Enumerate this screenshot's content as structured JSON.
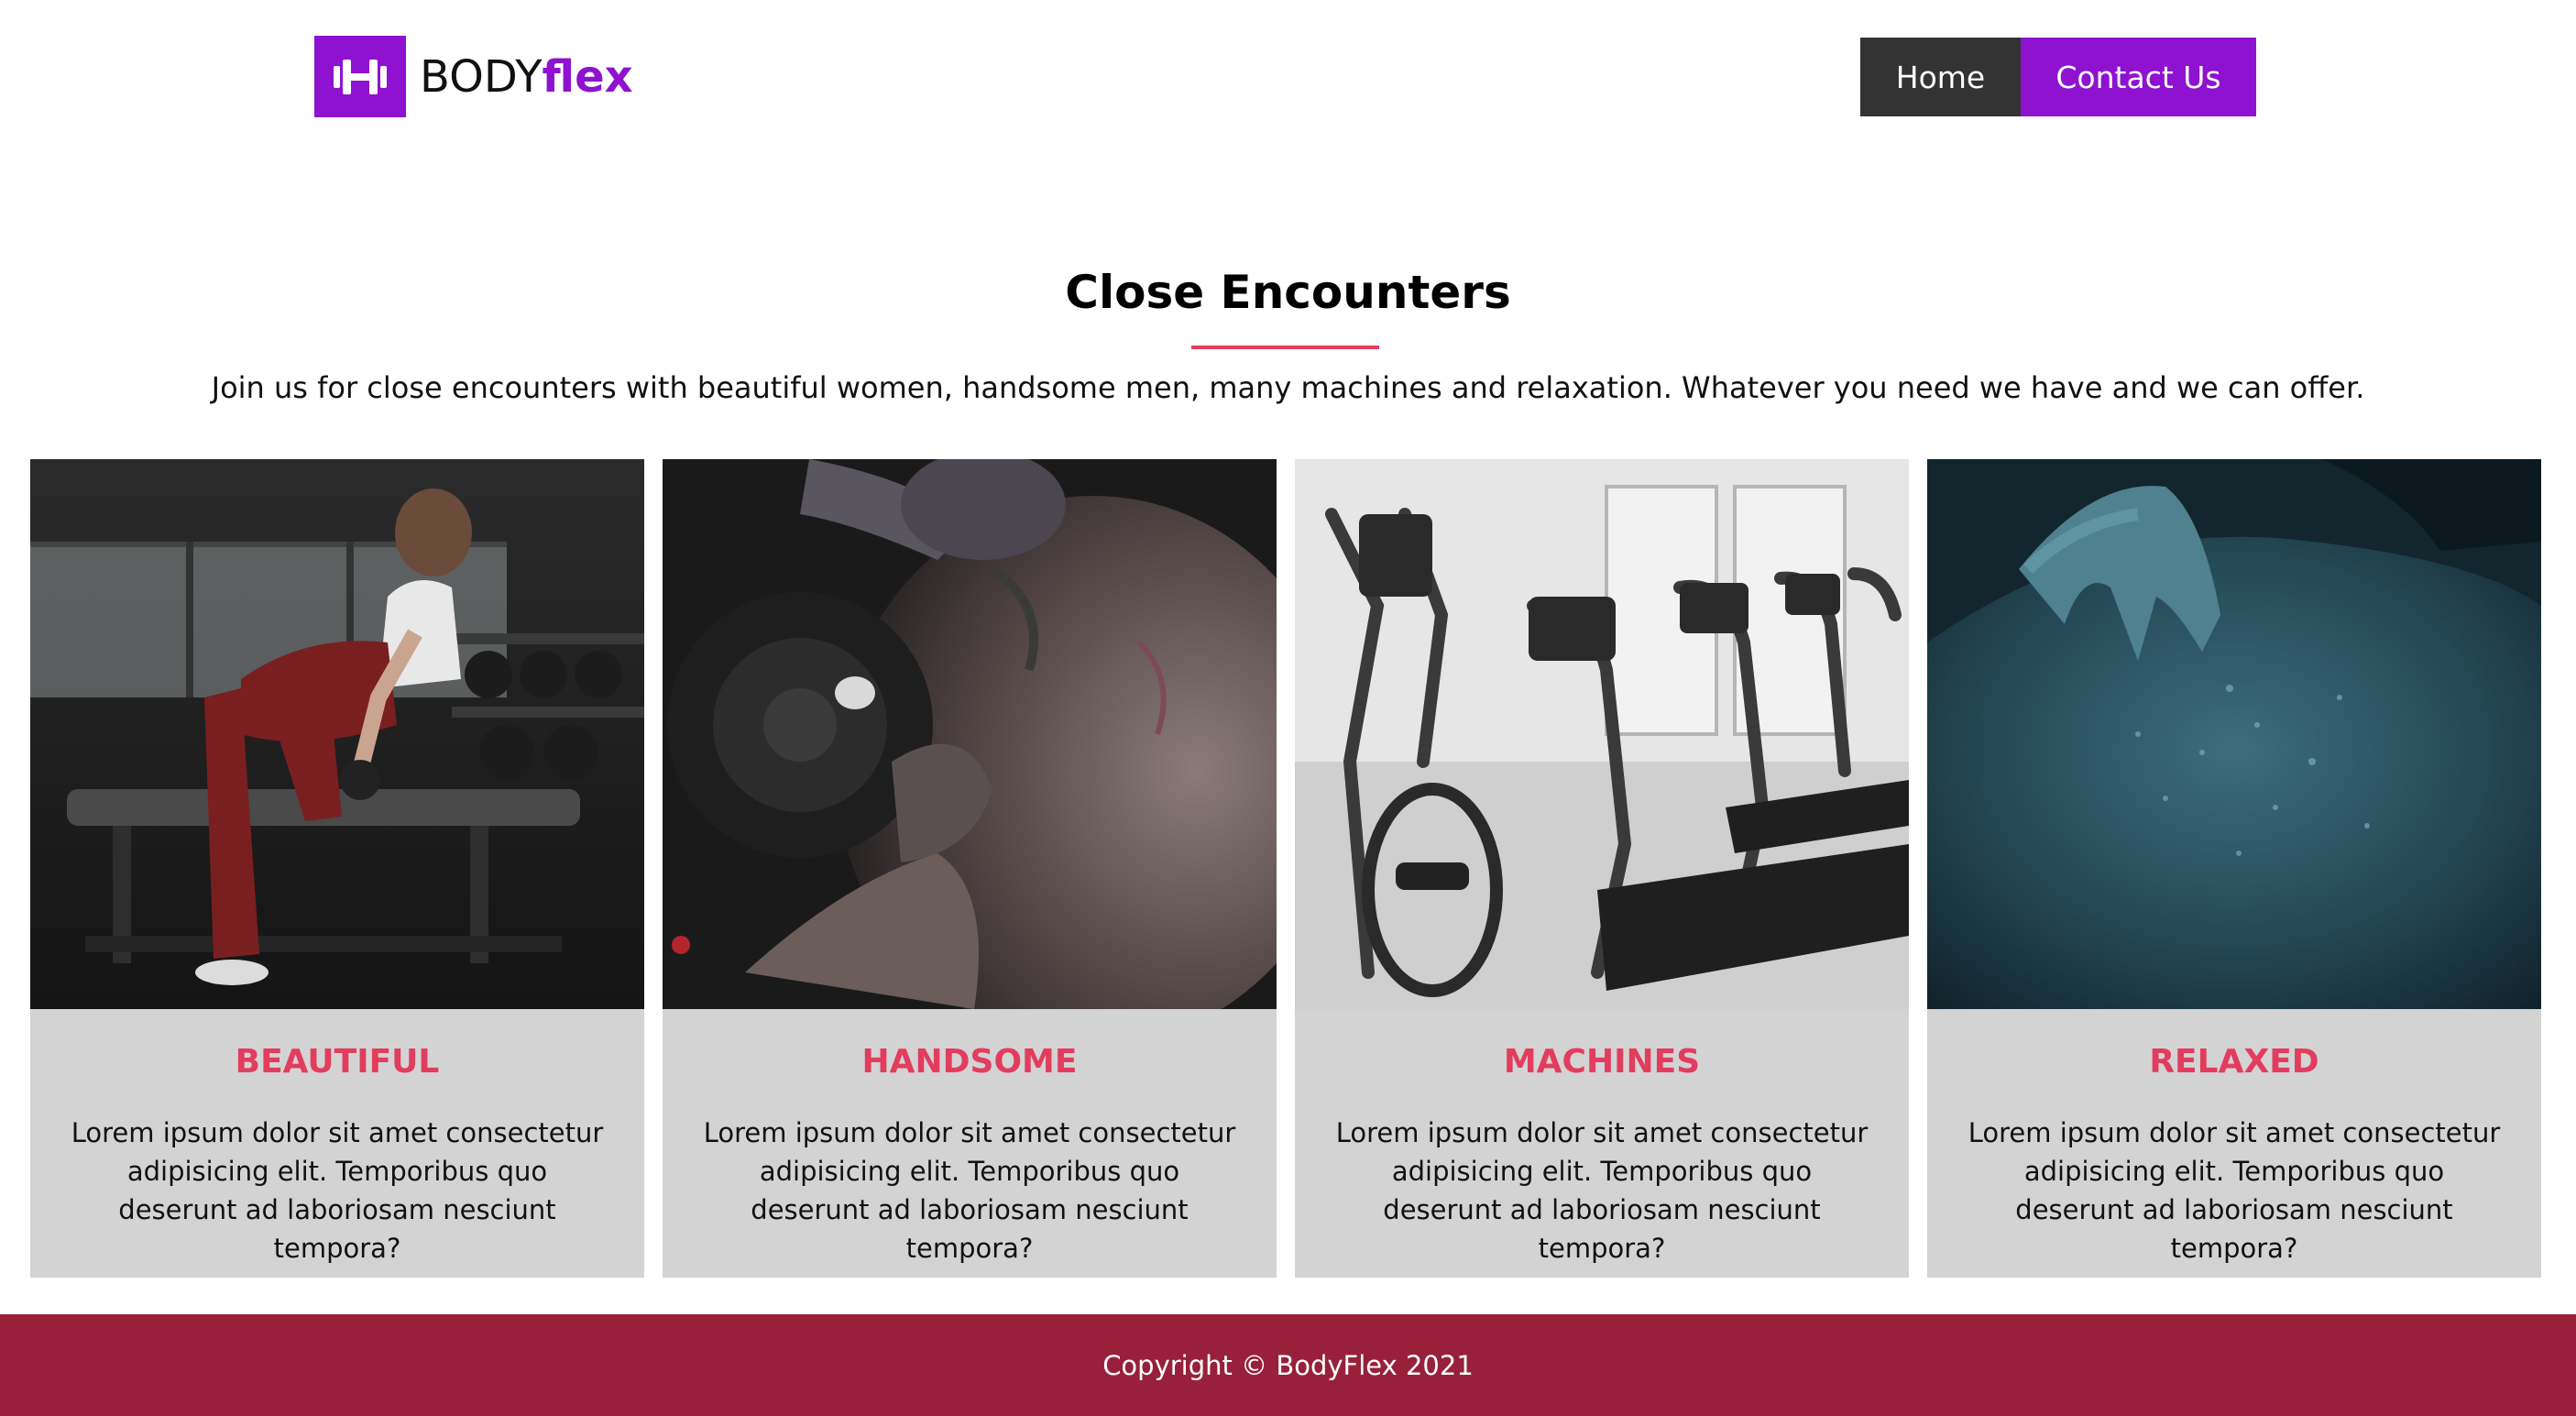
{
  "header": {
    "logo_text_regular": "BODY",
    "logo_text_bold": "flex",
    "logo_icon": "dumbbell-icon"
  },
  "nav": {
    "home_label": "Home",
    "contact_label": "Contact Us"
  },
  "section": {
    "title": "Close Encounters",
    "intro": "Join us for close encounters with beautiful women, handsome men, many machines and relaxation. Whatever you need we have and we can offer."
  },
  "cards": [
    {
      "title": "BEAUTIFUL",
      "text": "Lorem ipsum dolor sit amet consectetur adipisicing elit. Temporibus quo deserunt ad laboriosam nesciunt tempora?",
      "image": "woman-dumbbell-row-photo"
    },
    {
      "title": "HANDSOME",
      "text": "Lorem ipsum dolor sit amet consectetur adipisicing elit. Temporibus quo deserunt ad laboriosam nesciunt tempora?",
      "image": "man-bicep-curl-photo"
    },
    {
      "title": "MACHINES",
      "text": "Lorem ipsum dolor sit amet consectetur adipisicing elit. Temporibus quo deserunt ad laboriosam nesciunt tempora?",
      "image": "treadmills-photo"
    },
    {
      "title": "RELAXED",
      "text": "Lorem ipsum dolor sit amet consectetur adipisicing elit. Temporibus quo deserunt ad laboriosam nesciunt tempora?",
      "image": "shoulder-massage-photo"
    }
  ],
  "footer": {
    "copyright": "Copyright © BodyFlex 2021"
  },
  "colors": {
    "brand_purple": "#8f12d0",
    "accent_pink": "#e23d5e",
    "footer_bg": "#98203a",
    "card_bg": "#d3d3d3",
    "nav_home_bg": "#333333"
  }
}
